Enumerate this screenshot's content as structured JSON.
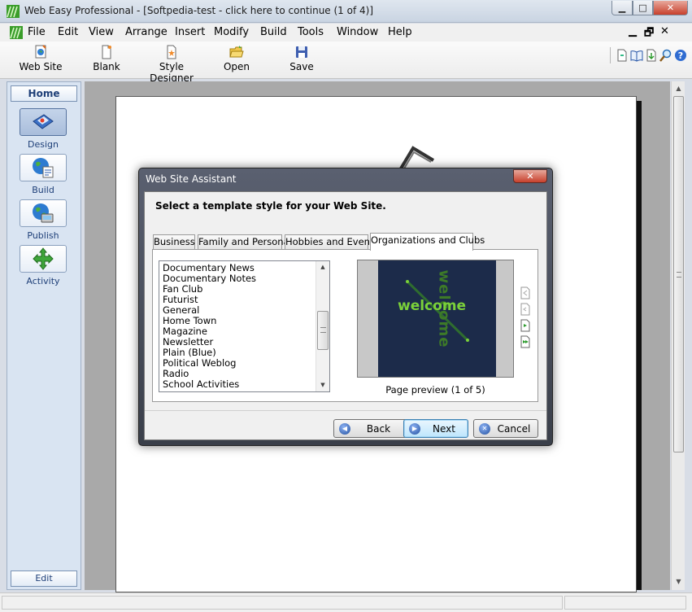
{
  "window": {
    "title": "Web Easy Professional - [Softpedia-test - click here to continue (1 of 4)]",
    "min_label": "▁",
    "max_label": "□",
    "close_label": "✕"
  },
  "menu": {
    "items": [
      "File",
      "Edit",
      "View",
      "Arrange",
      "Insert",
      "Modify",
      "Build",
      "Tools",
      "Window",
      "Help"
    ],
    "mdi_min": "▁",
    "mdi_restore": "🗗",
    "mdi_close": "✕"
  },
  "toolbar": {
    "buttons": [
      {
        "label": "Web Site",
        "icon": "web-site-icon"
      },
      {
        "label": "Blank",
        "icon": "blank-page-icon"
      },
      {
        "label": "Style Designer",
        "icon": "style-designer-icon"
      },
      {
        "label": "Open",
        "icon": "open-folder-icon"
      },
      {
        "label": "Save",
        "icon": "save-disk-icon"
      }
    ],
    "right_icons": [
      "page-icon",
      "book-icon",
      "export-icon",
      "zoom-icon",
      "help-icon"
    ]
  },
  "leftnav": {
    "home_label": "Home",
    "items": [
      {
        "label": "Design",
        "icon": "design-icon",
        "active": true
      },
      {
        "label": "Build",
        "icon": "build-icon",
        "active": false
      },
      {
        "label": "Publish",
        "icon": "publish-icon",
        "active": false
      },
      {
        "label": "Activity",
        "icon": "activity-icon",
        "active": false
      }
    ],
    "edit_label": "Edit"
  },
  "dialog": {
    "title": "Web Site Assistant",
    "close_label": "✕",
    "heading": "Select a template style for your Web Site.",
    "tabs": [
      "Business",
      "Family and Personal",
      "Hobbies and Events",
      "Organizations and Clubs"
    ],
    "active_tab": "Organizations and Clubs",
    "templates": [
      "Documentary News",
      "Documentary Notes",
      "Fan Club",
      "Futurist",
      "General",
      "Home Town",
      "Magazine",
      "Newsletter",
      "Plain (Blue)",
      "Political Weblog",
      "Radio",
      "School Activities"
    ],
    "preview": {
      "text_horizontal": "welcome",
      "text_vertical": "welcome",
      "caption": "Page preview (1 of 5)"
    },
    "buttons": {
      "back": "Back",
      "next": "Next",
      "cancel": "Cancel"
    }
  },
  "colors": {
    "preview_bg": "#1c2b4a",
    "preview_text": "#7bd13a",
    "dialog_frame": "#3a3f4a",
    "nav_bg": "#d9e4f2"
  }
}
